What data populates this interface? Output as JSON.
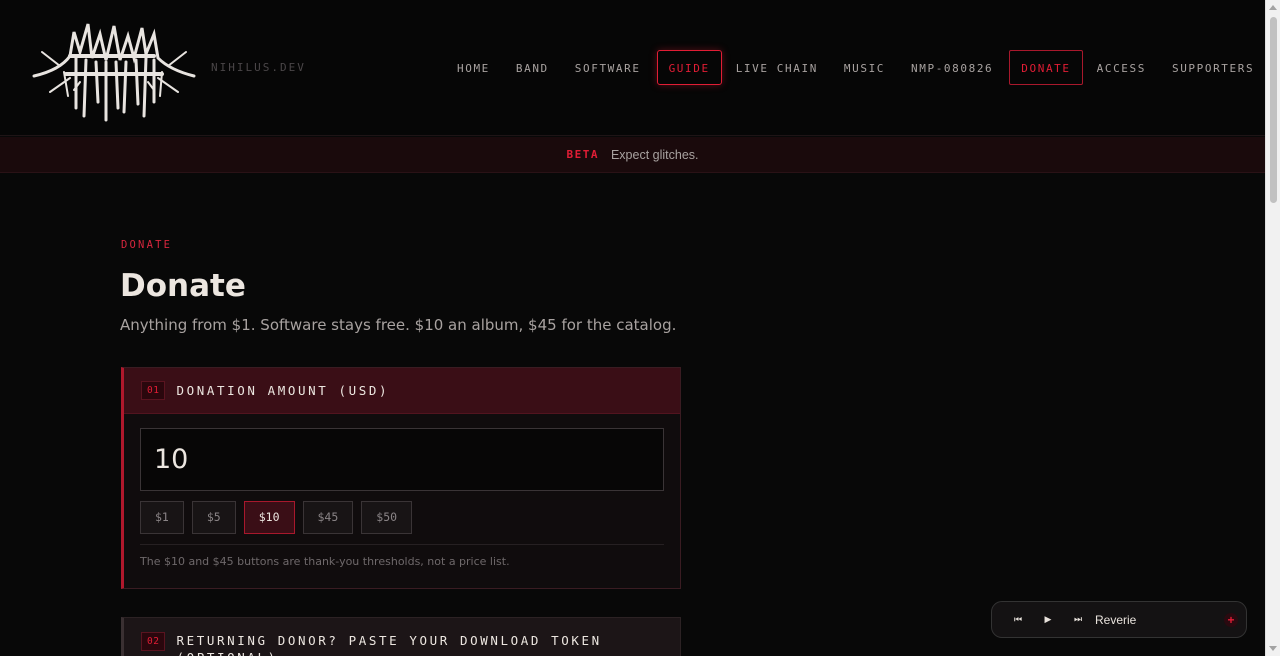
{
  "header": {
    "logo_icon": "nihilus-band-logo-icon",
    "domain": "NIHILUS.DEV",
    "nav": [
      {
        "label": "HOME"
      },
      {
        "label": "BAND"
      },
      {
        "label": "SOFTWARE"
      },
      {
        "label": "GUIDE"
      },
      {
        "label": "LIVE CHAIN"
      },
      {
        "label": "MUSIC"
      },
      {
        "label": "NMP-080826"
      },
      {
        "label": "DONATE"
      },
      {
        "label": "ACCESS"
      },
      {
        "label": "SUPPORTERS"
      }
    ]
  },
  "beta": {
    "tag": "BETA",
    "text": "Expect glitches."
  },
  "page": {
    "eyebrow": "DONATE",
    "title": "Donate",
    "subtitle": "Anything from $1. Software stays free. $10 an album, $45 for the catalog."
  },
  "donation": {
    "step": "01",
    "title": "DONATION AMOUNT (USD)",
    "amount_value": "10",
    "presets": [
      "$1",
      "$5",
      "$10",
      "$45",
      "$50"
    ],
    "selected_preset": "$10",
    "note": "The $10 and $45 buttons are thank-you thresholds, not a price list."
  },
  "returning": {
    "step": "02",
    "title": "RETURNING DONOR? PASTE YOUR DOWNLOAD TOKEN (OPTIONAL)"
  },
  "player": {
    "prev_icon": "skip-previous-icon",
    "play_icon": "play-icon",
    "next_icon": "skip-next-icon",
    "track": "Reverie",
    "close_icon": "close-icon"
  },
  "colors": {
    "accent": "#e11d35",
    "background": "#080808",
    "card_header": "#3a0e16"
  }
}
